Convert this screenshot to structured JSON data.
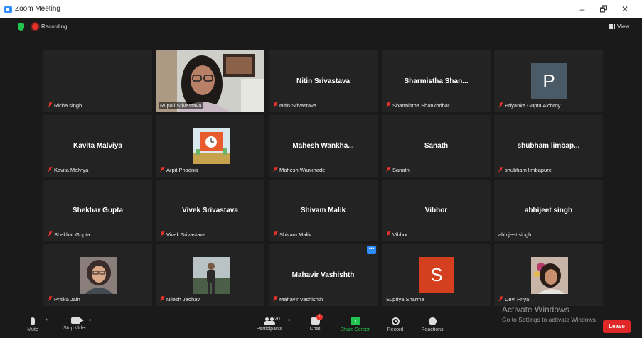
{
  "window": {
    "title": "Zoom Meeting",
    "controls": {
      "minimize": "–",
      "restore": "🗗",
      "close": "✕"
    }
  },
  "meeting": {
    "recording_label": "Recording",
    "view_label": "View"
  },
  "participants": [
    {
      "name": "Richa singh",
      "display": "",
      "muted": true,
      "type": "blank"
    },
    {
      "name": "Rupali Srivastava",
      "display": "",
      "muted": false,
      "type": "video",
      "speaking": true
    },
    {
      "name": "Nitin Srivastava",
      "display": "Nitin Srivastava",
      "muted": true,
      "type": "name"
    },
    {
      "name": "Sharmistha Shankhdhar",
      "display": "Sharmistha  Shan...",
      "muted": true,
      "type": "name"
    },
    {
      "name": "Priyanka Gupta Aichroy",
      "display": "P",
      "muted": true,
      "type": "letter",
      "color": "#4a5a66"
    },
    {
      "name": "Kavita Malviya",
      "display": "Kavita Malviya",
      "muted": true,
      "type": "name"
    },
    {
      "name": "Arpit Phadnis",
      "display": "",
      "muted": true,
      "type": "photo"
    },
    {
      "name": "Mahesh Wankhade",
      "display": "Mahesh  Wankha...",
      "muted": true,
      "type": "name"
    },
    {
      "name": "Sanath",
      "display": "Sanath",
      "muted": true,
      "type": "name"
    },
    {
      "name": "shubham limbapure",
      "display": "shubham  limbap...",
      "muted": true,
      "type": "name"
    },
    {
      "name": "Shekhar Gupta",
      "display": "Shekhar Gupta",
      "muted": true,
      "type": "name"
    },
    {
      "name": "Vivek Srivastava",
      "display": "Vivek Srivastava",
      "muted": true,
      "type": "name"
    },
    {
      "name": "Shivam Malik",
      "display": "Shivam Malik",
      "muted": true,
      "type": "name"
    },
    {
      "name": "Vibhor",
      "display": "Vibhor",
      "muted": true,
      "type": "name"
    },
    {
      "name": "abhijeet singh",
      "display": "abhijeet singh",
      "muted": false,
      "type": "name"
    },
    {
      "name": "Pritika Jain",
      "display": "",
      "muted": true,
      "type": "photo"
    },
    {
      "name": "Nilesh Jadhav",
      "display": "",
      "muted": true,
      "type": "photo"
    },
    {
      "name": "Mahavir Vashishth",
      "display": "Mahavir Vashishth",
      "muted": true,
      "type": "name"
    },
    {
      "name": "Supriya Sharma",
      "display": "S",
      "muted": false,
      "type": "letter",
      "color": "#d4401f"
    },
    {
      "name": "Devi Priya",
      "display": "",
      "muted": true,
      "type": "photo"
    }
  ],
  "toolbar": {
    "mute": "Mute",
    "stop_video": "Stop Video",
    "participants": "Participants",
    "participant_count": "20",
    "chat": "Chat",
    "chat_badge": "1",
    "share_screen": "Share Screen",
    "record": "Record",
    "reactions": "Reactions",
    "leave": "Leave"
  },
  "watermark": {
    "line1": "Activate Windows",
    "line2": "Go to Settings to activate Windows."
  },
  "colors": {
    "background": "#1a1a1a",
    "tile": "#232323",
    "speaker_outline": "#d9ec5b",
    "share_green": "#23c552",
    "leave_red": "#e02828"
  }
}
